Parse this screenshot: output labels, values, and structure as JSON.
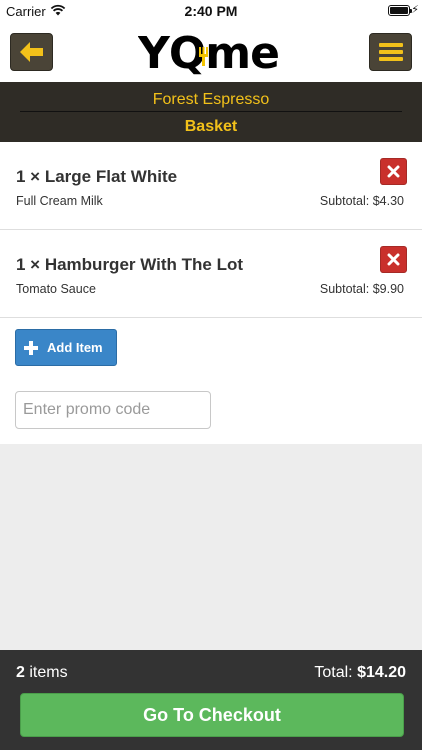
{
  "status_bar": {
    "carrier": "Carrier",
    "time": "2:40 PM"
  },
  "header": {
    "logo_text_dark": "YQ",
    "logo_text_accent": "me",
    "back_icon": "arrow-left-icon",
    "menu_icon": "hamburger-menu-icon"
  },
  "store": {
    "name": "Forest Espresso",
    "section_title": "Basket"
  },
  "basket": {
    "items": [
      {
        "title": "1 × Large Flat White",
        "option": "Full Cream Milk",
        "subtotal": "Subtotal: $4.30"
      },
      {
        "title": "1 × Hamburger With The Lot",
        "option": "Tomato Sauce",
        "subtotal": "Subtotal: $9.90"
      }
    ],
    "add_item_label": "Add Item",
    "promo_placeholder": "Enter promo code"
  },
  "footer": {
    "item_count": "2",
    "item_count_suffix": " items",
    "total_label": "Total: ",
    "total_value": "$14.20",
    "checkout_label": "Go To Checkout"
  },
  "colors": {
    "accent_yellow": "#f2c11a",
    "nav_button": "#4a4437",
    "remove_red": "#c9302c",
    "add_blue": "#3a86c8",
    "checkout_green": "#5cb85c",
    "footer_bg": "#333333"
  }
}
